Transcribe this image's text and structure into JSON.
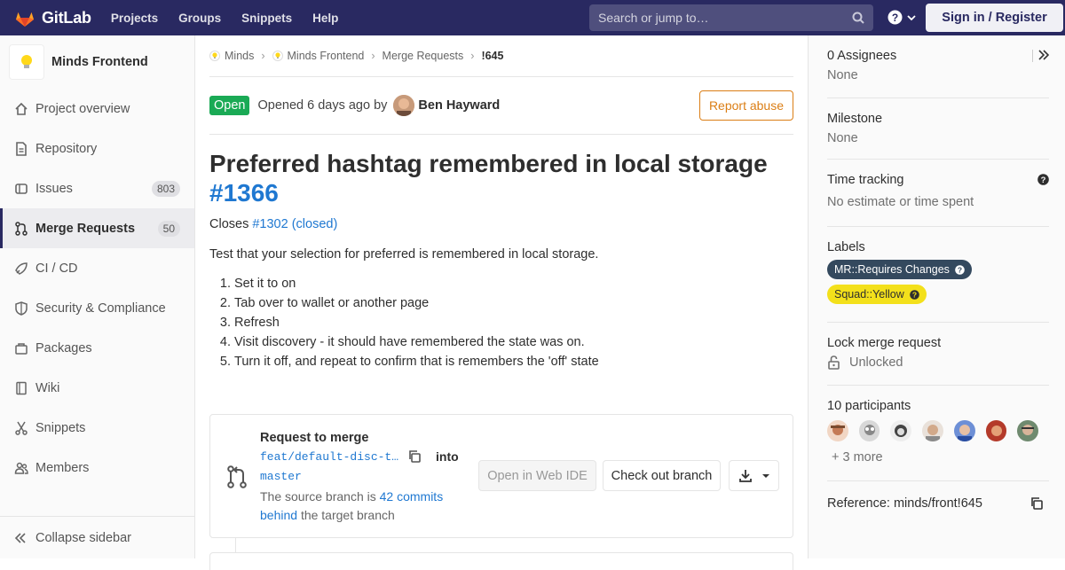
{
  "topbar": {
    "brand": "GitLab",
    "nav": [
      "Projects",
      "Groups",
      "Snippets",
      "Help"
    ],
    "search_placeholder": "Search or jump to…",
    "signin": "Sign in / Register"
  },
  "sidebar": {
    "project_name": "Minds Frontend",
    "items": [
      {
        "label": "Project overview",
        "icon": "home-icon"
      },
      {
        "label": "Repository",
        "icon": "doc-icon"
      },
      {
        "label": "Issues",
        "icon": "issues-icon",
        "count": "803"
      },
      {
        "label": "Merge Requests",
        "icon": "merge-request-icon",
        "count": "50",
        "active": true
      },
      {
        "label": "CI / CD",
        "icon": "rocket-icon"
      },
      {
        "label": "Security & Compliance",
        "icon": "shield-icon"
      },
      {
        "label": "Packages",
        "icon": "package-icon"
      },
      {
        "label": "Wiki",
        "icon": "book-icon"
      },
      {
        "label": "Snippets",
        "icon": "scissors-icon"
      },
      {
        "label": "Members",
        "icon": "users-icon"
      }
    ],
    "collapse_label": "Collapse sidebar"
  },
  "breadcrumbs": [
    "Minds",
    "Minds Frontend",
    "Merge Requests",
    "!645"
  ],
  "mr": {
    "status": "Open",
    "opened_text": "Opened 6 days ago by",
    "author": "Ben Hayward",
    "report_abuse": "Report abuse",
    "title": "Preferred hashtag remembered in local storage",
    "title_ref": "#1366",
    "closes_prefix": "Closes",
    "closes_link": "#1302 (closed)",
    "description": "Test that your selection for preferred is remembered in local storage.",
    "steps": [
      "Set it to on",
      "Tab over to wallet or another page",
      "Refresh",
      "Visit discovery - it should have remembered the state was on.",
      "Turn it off, and repeat to confirm that is remembers the 'off' state"
    ]
  },
  "widget": {
    "title": "Request to merge",
    "source_branch": "feat/default-disc-t…",
    "into": "into",
    "target_branch": "master",
    "behind_prefix": "The source branch is",
    "behind_link": "42 commits behind",
    "behind_suffix": "the target branch",
    "open_ide": "Open in Web IDE",
    "checkout": "Check out branch"
  },
  "right_sidebar": {
    "assignees_label": "0 Assignees",
    "assignees_value": "None",
    "milestone_label": "Milestone",
    "milestone_value": "None",
    "time_label": "Time tracking",
    "time_value": "No estimate or time spent",
    "labels_label": "Labels",
    "labels": [
      {
        "text": "MR::Requires Changes",
        "color": "#34495e"
      },
      {
        "text": "Squad::Yellow",
        "color": "#f3e01b"
      }
    ],
    "lock_label": "Lock merge request",
    "lock_value": "Unlocked",
    "participants_label": "10 participants",
    "participants_more": "+ 3 more",
    "reference": "Reference: minds/front!645"
  },
  "colors": {
    "navbar": "#292961",
    "open_badge": "#1aaa55",
    "link": "#1f78d1",
    "report_abuse": "#db7e15"
  }
}
